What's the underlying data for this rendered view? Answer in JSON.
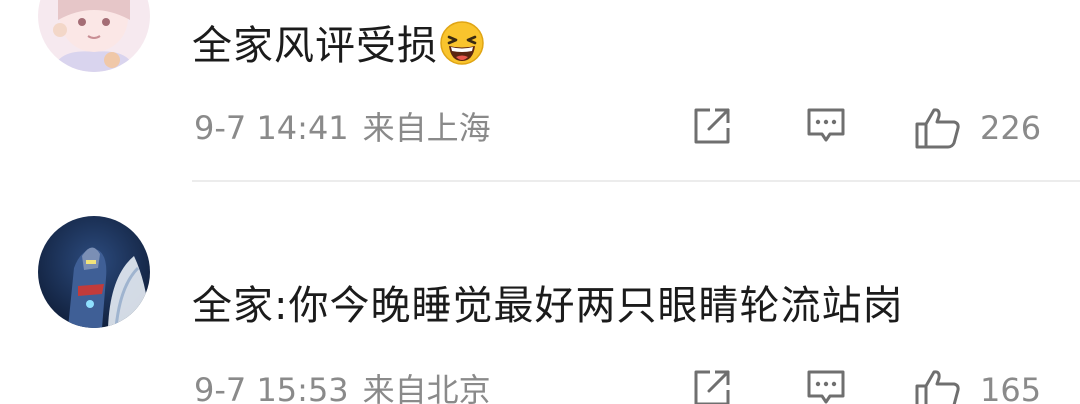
{
  "comments": [
    {
      "text": "全家风评受损",
      "emoji": "grinning-squint-emoji",
      "time": "9-7 14:41",
      "location": "来自上海",
      "likes": "226",
      "icons": [
        "share-icon",
        "comment-icon",
        "thumbs-up-icon"
      ]
    },
    {
      "text": "全家:你今晚睡觉最好两只眼睛轮流站岗",
      "time": "9-7 15:53",
      "location": "来自北京",
      "likes": "165",
      "icons": [
        "share-icon",
        "comment-icon",
        "thumbs-up-icon"
      ]
    }
  ],
  "colors": {
    "text": "#1b1b1b",
    "meta": "#8a8a8a",
    "icon": "#6f6f6f",
    "divider": "#ececec"
  }
}
